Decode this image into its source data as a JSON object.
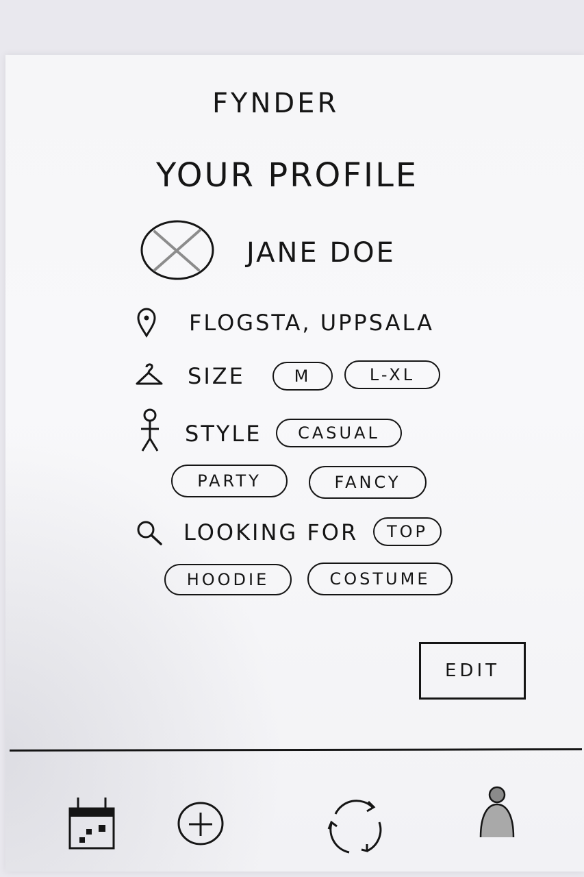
{
  "header": {
    "app_title": "FYNDER"
  },
  "profile": {
    "page_title": "YOUR PROFILE",
    "name": "JANE DOE",
    "location": "FLOGSTA, UPPSALA"
  },
  "size": {
    "label": "SIZE",
    "chips": [
      "M",
      "L-XL"
    ]
  },
  "style": {
    "label": "STYLE",
    "chips": [
      "CASUAL",
      "PARTY",
      "FANCY"
    ]
  },
  "looking_for": {
    "label": "LOOKING FOR",
    "chips": [
      "TOP",
      "HOODIE",
      "COSTUME"
    ]
  },
  "actions": {
    "edit_label": "EDIT"
  },
  "nav": {
    "items": [
      "calendar-icon",
      "add-icon",
      "swap-icon",
      "profile-icon"
    ]
  },
  "colors": {
    "ink": "#151515",
    "paper": "#f6f6f8",
    "pencil_gray": "#a9a9a9"
  }
}
